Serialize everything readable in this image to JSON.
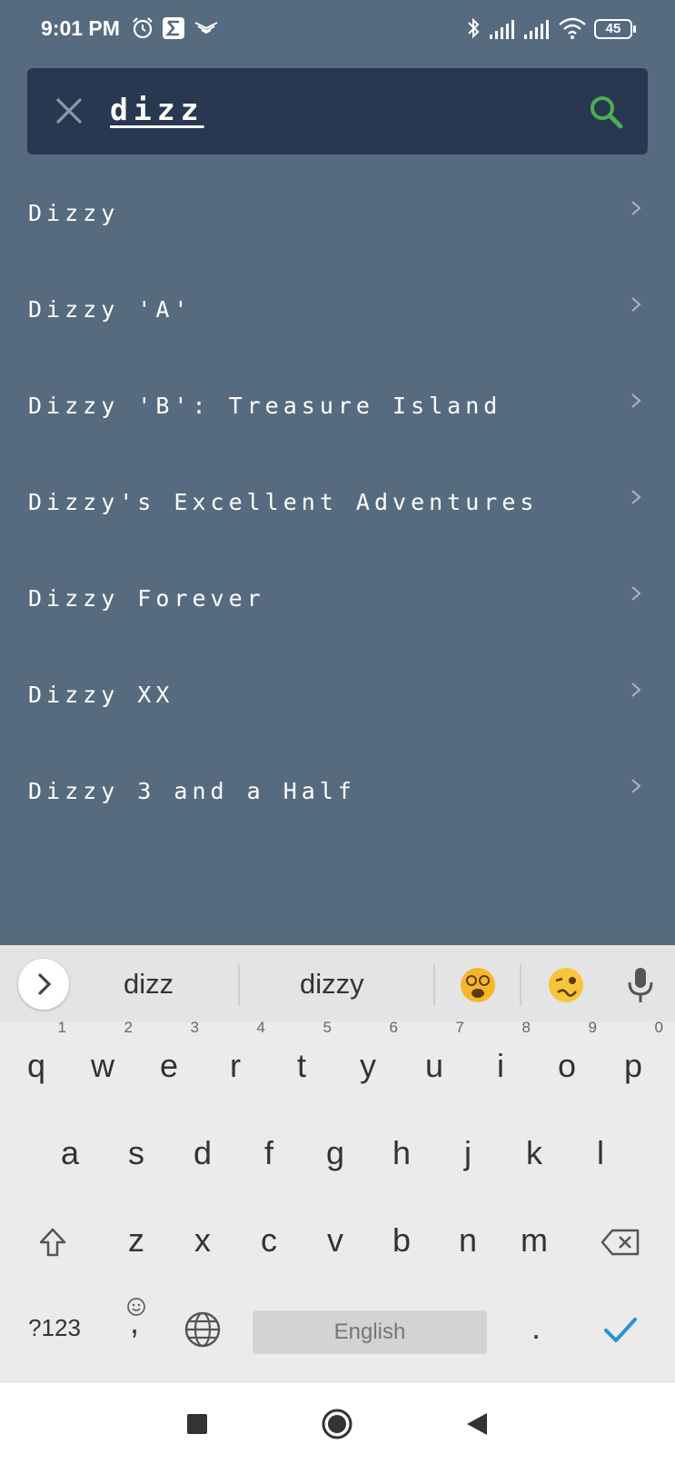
{
  "status_bar": {
    "time": "9:01 PM",
    "battery": "45"
  },
  "search": {
    "query": "dizz"
  },
  "results": [
    {
      "label": "Dizzy"
    },
    {
      "label": "Dizzy 'A'"
    },
    {
      "label": "Dizzy 'B': Treasure Island"
    },
    {
      "label": "Dizzy's Excellent Adventures"
    },
    {
      "label": "Dizzy Forever"
    },
    {
      "label": "Dizzy XX"
    },
    {
      "label": "Dizzy 3 and a Half"
    }
  ],
  "keyboard": {
    "suggestions": [
      "dizz",
      "dizzy"
    ],
    "row1": [
      "q",
      "w",
      "e",
      "r",
      "t",
      "y",
      "u",
      "i",
      "o",
      "p"
    ],
    "row1_nums": [
      "1",
      "2",
      "3",
      "4",
      "5",
      "6",
      "7",
      "8",
      "9",
      "0"
    ],
    "row2": [
      "a",
      "s",
      "d",
      "f",
      "g",
      "h",
      "j",
      "k",
      "l"
    ],
    "row3": [
      "z",
      "x",
      "c",
      "v",
      "b",
      "n",
      "m"
    ],
    "symbols_key": "?123",
    "comma": ",",
    "space_label": "English",
    "period": "."
  },
  "colors": {
    "app_background": "#566b80",
    "search_bar": "#273850",
    "search_icon": "#4caf50",
    "confirm_check": "#2b8fd6"
  }
}
